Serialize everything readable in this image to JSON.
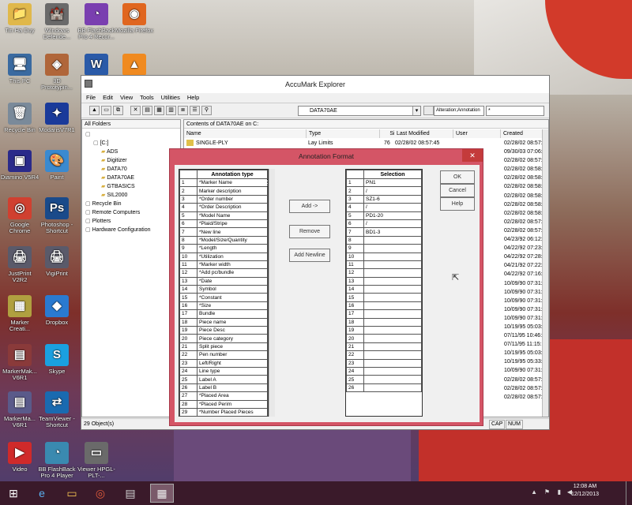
{
  "desktop": {
    "icons": [
      {
        "label": "Tin Ha Duy",
        "glyph": "📁",
        "color": "#e0b84a"
      },
      {
        "label": "Windows Defende...",
        "glyph": "🏰",
        "color": "#6a6a6a"
      },
      {
        "label": "BB FlashBack Pro 4 Recor...",
        "glyph": "◔",
        "color": "#7a3fb0"
      },
      {
        "label": "Mozilla Firefox",
        "glyph": "◉",
        "color": "#e0661f"
      },
      {
        "label": "This PC",
        "glyph": "🖥",
        "color": "#3a6aa0"
      },
      {
        "label": "3D Prototypin...",
        "glyph": "◈",
        "color": "#b0663a"
      },
      {
        "label": "W",
        "glyph": "W",
        "color": "#2a5aa8"
      },
      {
        "label": "",
        "glyph": "▲",
        "color": "#f08a20"
      },
      {
        "label": "Recycle Bin",
        "glyph": "🗑",
        "color": "#7a8a9a"
      },
      {
        "label": "ModarisV7R1",
        "glyph": "✦",
        "color": "#1a3a9a"
      },
      {
        "label": "Diamino V5R4",
        "glyph": "▣",
        "color": "#2a2a8a"
      },
      {
        "label": "Paint",
        "glyph": "🎨",
        "color": "#3a8ad0"
      },
      {
        "label": "Google Chrome",
        "glyph": "◎",
        "color": "#d04030"
      },
      {
        "label": "Photoshop - Shortcut",
        "glyph": "Ps",
        "color": "#1a4a8a"
      },
      {
        "label": "JustPrint V2R2",
        "glyph": "🖨",
        "color": "#5a5a6a"
      },
      {
        "label": "VigiPrint",
        "glyph": "🖨",
        "color": "#5a5a6a"
      },
      {
        "label": "Marker Creati...",
        "glyph": "▦",
        "color": "#b0a040"
      },
      {
        "label": "Dropbox",
        "glyph": "◆",
        "color": "#2a7ad0"
      },
      {
        "label": "MarkerMak... V6R1",
        "glyph": "▤",
        "color": "#8a3a3a"
      },
      {
        "label": "Skype",
        "glyph": "S",
        "color": "#1aa0e0"
      },
      {
        "label": "MarkerMa... V6R1",
        "glyph": "▤",
        "color": "#5a5a8a"
      },
      {
        "label": "TeamViewer - Shortcut",
        "glyph": "⇄",
        "color": "#1a6ab0"
      },
      {
        "label": "Video",
        "glyph": "▶",
        "color": "#d02a2a"
      },
      {
        "label": "BB FlashBack Pro 4 Player",
        "glyph": "◔",
        "color": "#3a8ab0"
      },
      {
        "label": "Viewer HPGL-PLT-...",
        "glyph": "▭",
        "color": "#6a6a6a"
      }
    ]
  },
  "explorer": {
    "title": "AccuMark Explorer",
    "menu": [
      "File",
      "Edit",
      "View",
      "Tools",
      "Utilities",
      "Help"
    ],
    "path_combo": "DATA70AE",
    "alteration_field": "Alteration;Annotation",
    "alteration_value": "*",
    "left_header": "All Folders",
    "contents_header": "Contents of DATA70AE on C:",
    "columns": [
      "Name",
      "Type",
      "Size",
      "Last Modified",
      "User",
      "Created"
    ],
    "tree": [
      {
        "label": "",
        "indent": 0
      },
      {
        "label": "[C:]",
        "indent": 1
      },
      {
        "label": "ADS",
        "indent": 2
      },
      {
        "label": "Digitizer",
        "indent": 2
      },
      {
        "label": "DATA70",
        "indent": 2
      },
      {
        "label": "DATA70AE",
        "indent": 2
      },
      {
        "label": "GTBASICS",
        "indent": 2
      },
      {
        "label": "SIL2000",
        "indent": 2
      },
      {
        "label": "Recycle Bin",
        "indent": 0
      },
      {
        "label": "Remote Computers",
        "indent": 0
      },
      {
        "label": "Plotters",
        "indent": 0
      },
      {
        "label": "Hardware Configuration",
        "indent": 0
      }
    ],
    "first_row": {
      "name": "SINGLE-PLY",
      "type": "Lay Limits",
      "size": "76",
      "modified": "02/28/02 08:57:45"
    },
    "created_dates": [
      "02/28/02 08:57:4",
      "09/30/03 07:06:2",
      "02/28/02 08:57:4",
      "02/28/02 08:58:1",
      "02/28/02 08:58:1",
      "02/28/02 08:58:1",
      "02/28/02 08:58:1",
      "02/28/02 08:58:1",
      "02/28/02 08:58:1",
      "02/28/02 08:57:5",
      "02/28/02 08:57:5",
      "04/23/92 06:12:4",
      "04/22/92 07:23:5",
      "04/22/92 07:28:0",
      "04/21/92 07:22:4",
      "04/22/92 07:16:5",
      "10/09/90 07:31:1",
      "10/09/90 07:31:1",
      "10/09/90 07:31:1",
      "10/09/90 07:31:1",
      "10/09/90 07:31:1",
      "10/19/95 05:03:4",
      "07/11/95 10:46:3",
      "07/11/95 11:15:5",
      "10/19/95 05:03:4",
      "10/19/95 05:33:2",
      "10/09/90 07:31:1",
      "02/28/02 08:57:4",
      "02/28/02 08:57:4",
      "02/28/02 08:57:4"
    ],
    "status": "29 Object(s)",
    "cap": "CAP",
    "num": "NUM"
  },
  "dialog": {
    "title": "Annotation Format",
    "left_header": "Annotation type",
    "annotation_types": [
      "*Marker Name",
      "Marker description",
      "*Order number",
      "*Order Description",
      "*Model Name",
      "*Plaid/Stripe",
      "*New line",
      "*Model/Size/Quantity",
      "*Length",
      "*Utilization",
      "*Marker width",
      "*Add pc/bundle",
      "*Date",
      "Symbol",
      "*Constant",
      "*Size",
      "Bundle",
      "Piece name",
      "Piece Desc",
      "Piece category",
      "Split piece",
      "Pen number",
      "Left/Right",
      "Line type",
      "Label A",
      "Label B",
      "*Placed Area",
      "*Placed Perim",
      "*Number Placed Pieces"
    ],
    "right_header": "Selection",
    "selection": [
      "PN1",
      "/",
      "SZ1-6",
      "/",
      "PD1-20",
      "/",
      "BD1-3",
      "",
      "",
      "",
      "",
      "",
      "",
      "",
      "",
      "",
      "",
      "",
      "",
      "",
      "",
      "",
      "",
      "",
      "",
      ""
    ],
    "add_label": "Add ->",
    "remove_label": "Remove",
    "newline_label": "Add Newline",
    "ok_label": "OK",
    "cancel_label": "Cancel",
    "help_label": "Help"
  },
  "taskbar": {
    "time": "12:08 AM",
    "date": "12/12/2013"
  }
}
